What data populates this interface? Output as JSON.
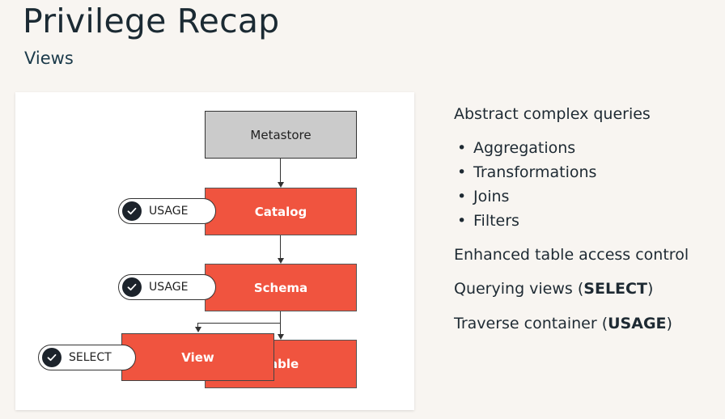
{
  "header": {
    "title": "Privilege Recap",
    "subtitle": "Views"
  },
  "diagram": {
    "nodes": {
      "metastore": "Metastore",
      "catalog": "Catalog",
      "schema": "Schema",
      "table": "Table",
      "view": "View"
    },
    "badges": {
      "catalog": "USAGE",
      "schema": "USAGE",
      "view": "SELECT"
    },
    "colors": {
      "node_red": "#f0543f",
      "node_grey": "#cbcbcb",
      "check_circle": "#1c232b"
    }
  },
  "notes": {
    "heading": "Abstract complex queries",
    "bullets": [
      "Aggregations",
      "Transformations",
      "Joins",
      "Filters"
    ],
    "enhanced": "Enhanced table access control",
    "querying_prefix": "Querying views (",
    "querying_bold": "SELECT",
    "querying_suffix": ")",
    "traverse_prefix": "Traverse container (",
    "traverse_bold": "USAGE",
    "traverse_suffix": ")"
  }
}
